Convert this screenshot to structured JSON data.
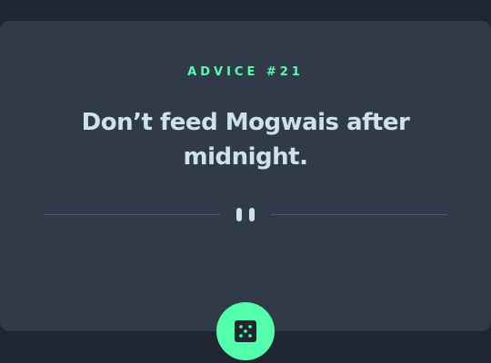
{
  "advice": {
    "id_label": "ADVICE #21",
    "quote": "Don’t feed Mogwais after midnight."
  },
  "divider": {
    "icon": "pause-icon"
  },
  "action": {
    "icon": "dice-icon",
    "button_name": "generate-advice-button"
  },
  "colors": {
    "background": "#1f2632",
    "card": "#313a48",
    "accent": "#53ffaa",
    "text": "#cee3e9",
    "divider_line": "#4f5d74"
  }
}
